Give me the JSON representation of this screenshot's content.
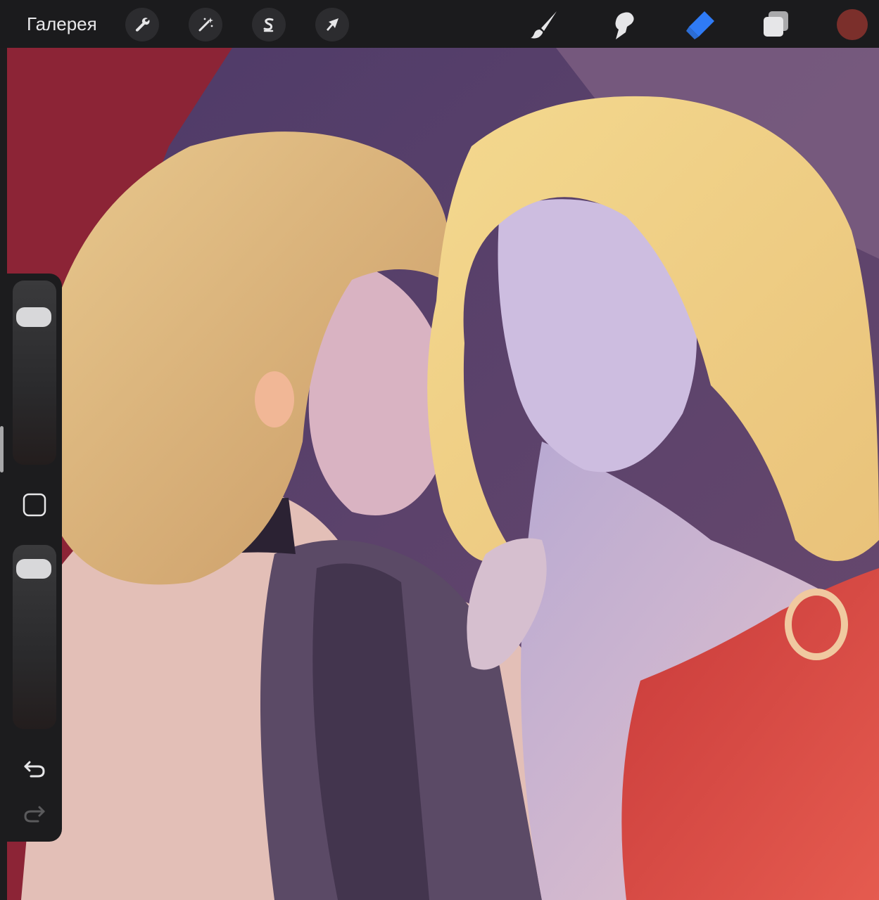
{
  "topbar": {
    "gallery_label": "Галерея",
    "actions_icon": "wrench-icon",
    "adjustments_icon": "magic-wand-icon",
    "selection_icon": "selection-s-icon",
    "transform_icon": "transform-arrow-icon",
    "brush_icon": "brush-icon",
    "smudge_icon": "smudge-icon",
    "eraser_icon": "eraser-icon",
    "layers_icon": "layers-icon",
    "active_tool": "eraser",
    "current_color": "#7b2f2b",
    "active_tool_color": "#2f7bf5"
  },
  "sidebar": {
    "brush_size_level": 0.85,
    "opacity_level": 0.93,
    "modify_icon": "square-icon",
    "undo_icon": "undo-icon",
    "redo_icon": "redo-icon"
  },
  "canvas": {
    "content": "artwork"
  }
}
